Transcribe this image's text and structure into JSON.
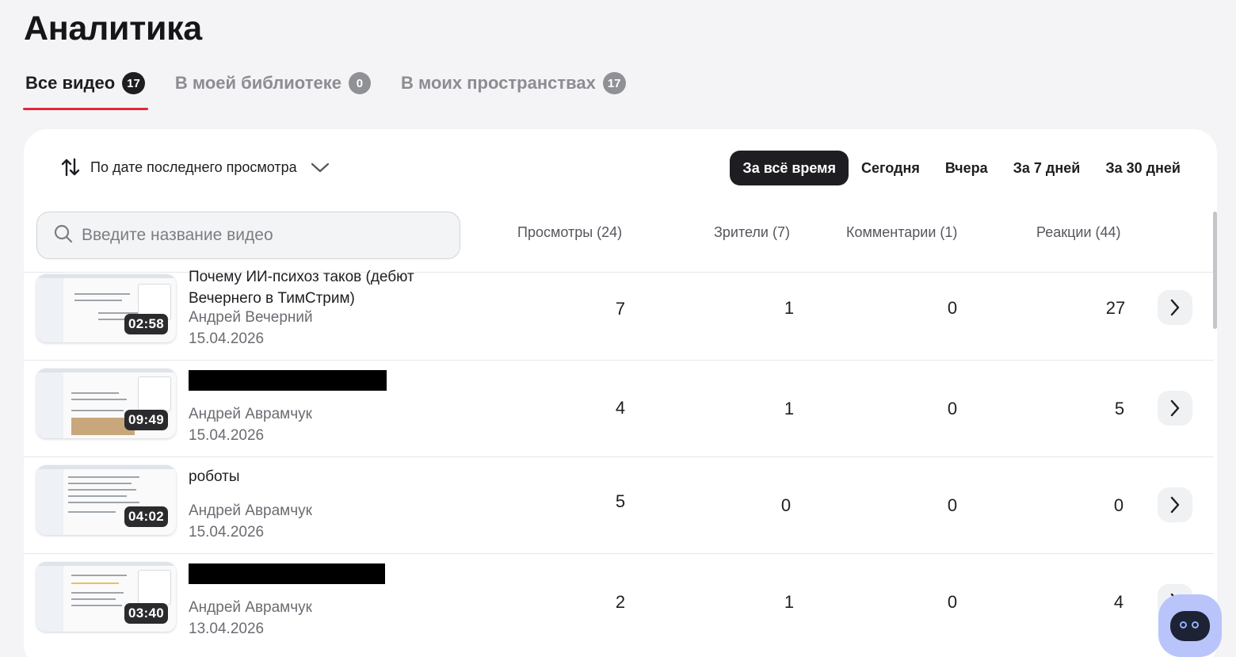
{
  "page": {
    "title": "Аналитика"
  },
  "tabs": [
    {
      "label": "Все видео",
      "count": "17",
      "active": true
    },
    {
      "label": "В моей библиотеке",
      "count": "0",
      "active": false
    },
    {
      "label": "В моих пространствах",
      "count": "17",
      "active": false
    }
  ],
  "sort": {
    "label": "По дате последнего просмотра"
  },
  "periods": [
    {
      "label": "За всё время",
      "active": true
    },
    {
      "label": "Сегодня",
      "active": false
    },
    {
      "label": "Вчера",
      "active": false
    },
    {
      "label": "За 7 дней",
      "active": false
    },
    {
      "label": "За 30 дней",
      "active": false
    }
  ],
  "search": {
    "placeholder": "Введите название видео"
  },
  "columns": {
    "views": "Просмотры (24)",
    "viewers": "Зрители (7)",
    "comments": "Комментарии (1)",
    "reactions": "Реакции (44)"
  },
  "videos": [
    {
      "title_line1": "Почему ИИ-психоз таков (дебют",
      "title_line2": "Вечернего в ТимСтрим)",
      "redacted": false,
      "author": "Андрей Вечерний",
      "date": "15.04.2026",
      "duration": "02:58",
      "views": "7",
      "viewers": "1",
      "comments": "0",
      "reactions": "27"
    },
    {
      "title_line1": "",
      "title_line2": "",
      "redacted": true,
      "author": "Андрей Аврамчук",
      "date": "15.04.2026",
      "duration": "09:49",
      "views": "4",
      "viewers": "1",
      "comments": "0",
      "reactions": "5"
    },
    {
      "title_line1": "роботы",
      "title_line2": "",
      "redacted": false,
      "author": "Андрей Аврамчук",
      "date": "15.04.2026",
      "duration": "04:02",
      "views": "5",
      "viewers": "0",
      "comments": "0",
      "reactions": "0"
    },
    {
      "title_line1": "",
      "title_line2": "",
      "redacted": true,
      "author": "Андрей Аврамчук",
      "date": "13.04.2026",
      "duration": "03:40",
      "views": "2",
      "viewers": "1",
      "comments": "0",
      "reactions": "4"
    }
  ],
  "icons": {
    "sort": "sort-arrows-icon",
    "dropdown": "chevron-down-icon",
    "search": "search-icon",
    "row_open": "chevron-right-icon",
    "assistant": "robot-assistant-icon"
  },
  "colors": {
    "accent": "#e0283f",
    "active_pill": "#1e1e22",
    "assistant_bg": "#b9c4fb"
  }
}
